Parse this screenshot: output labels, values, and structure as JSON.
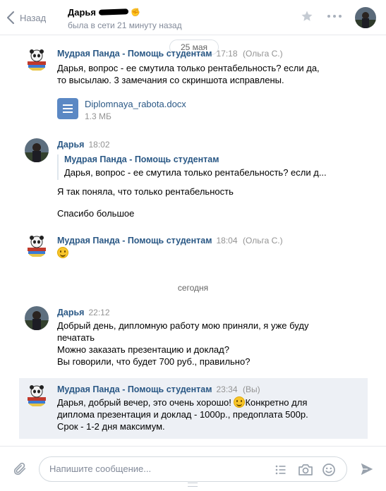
{
  "header": {
    "back_label": "Назад",
    "peer_name": "Дарья",
    "peer_status": "была в сети 21 минуту назад"
  },
  "date_divider": "25 мая",
  "today_divider": "сегодня",
  "messages": [
    {
      "author": "Мудрая Панда - Помощь студентам",
      "time": "17:18",
      "sender": "(Ольга С.)",
      "text": "Дарья, вопрос - ее смутила только рентабельность? если да,\nто высылаю. 3 замечания со скриншота исправлены.",
      "attachment": {
        "name": "Diplomnaya_rabota.docx",
        "size": "1.3 МБ"
      }
    },
    {
      "author": "Дарья",
      "time": "18:02",
      "quote": {
        "author": "Мудрая Панда - Помощь студентам",
        "text": "Дарья, вопрос - ее смутила только рентабельность? если д..."
      },
      "text1": "Я так поняла, что только рентабельность",
      "text2": "Спасибо большое"
    },
    {
      "author": "Мудрая Панда - Помощь студентам",
      "time": "18:04",
      "sender": "(Ольга С.)"
    },
    {
      "author": "Дарья",
      "time": "22:12",
      "text": "Добрый день, дипломную работу мою приняли, я уже буду\nпечатать\nМожно заказать презентацию и доклад?\nВы говорили, что будет 700 руб., правильно?"
    },
    {
      "author": "Мудрая Панда - Помощь студентам",
      "time": "23:34",
      "sender": "(Вы)",
      "text_a": "Дарья, добрый вечер, это очень хорошо! ",
      "text_b": "Конкретно для",
      "text_c": "диплома презентация и доклад - 1000р., предоплата 500р.\nСрок - 1-2 дня максимум."
    }
  ],
  "composer": {
    "placeholder": "Напишите сообщение..."
  },
  "colors": {
    "link": "#2a5885",
    "muted": "#828a99",
    "highlight_bg": "#edf0f5",
    "doc_icon": "#5b88c4"
  }
}
